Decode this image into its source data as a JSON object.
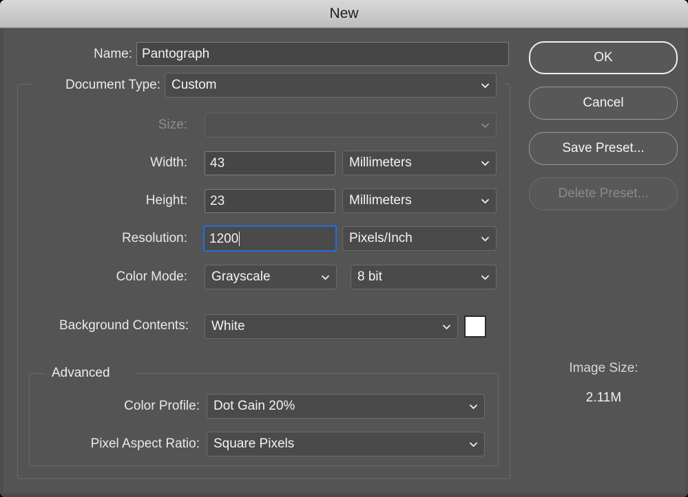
{
  "window": {
    "title": "New"
  },
  "form": {
    "name": {
      "label": "Name:",
      "value": "Pantograph"
    },
    "document_type": {
      "label": "Document Type:",
      "value": "Custom"
    },
    "size": {
      "label": "Size:",
      "value": ""
    },
    "width": {
      "label": "Width:",
      "value": "43",
      "unit": "Millimeters"
    },
    "height": {
      "label": "Height:",
      "value": "23",
      "unit": "Millimeters"
    },
    "resolution": {
      "label": "Resolution:",
      "value": "1200",
      "unit": "Pixels/Inch"
    },
    "color_mode": {
      "label": "Color Mode:",
      "value": "Grayscale",
      "depth": "8 bit"
    },
    "background_contents": {
      "label": "Background Contents:",
      "value": "White",
      "swatch_color": "#ffffff"
    }
  },
  "advanced": {
    "legend": "Advanced",
    "color_profile": {
      "label": "Color Profile:",
      "value": "Dot Gain 20%"
    },
    "pixel_aspect_ratio": {
      "label": "Pixel Aspect Ratio:",
      "value": "Square Pixels"
    }
  },
  "buttons": {
    "ok": "OK",
    "cancel": "Cancel",
    "save_preset": "Save Preset...",
    "delete_preset": "Delete Preset..."
  },
  "image_size": {
    "label": "Image Size:",
    "value": "2.11M"
  },
  "colors": {
    "dialog_bg": "#545454",
    "field_bg": "#464646",
    "focus_border": "#1f6fe0",
    "titlebar_top": "#d8d8d8",
    "text": "#f2f2f2",
    "disabled_text": "#8a8a8a"
  }
}
